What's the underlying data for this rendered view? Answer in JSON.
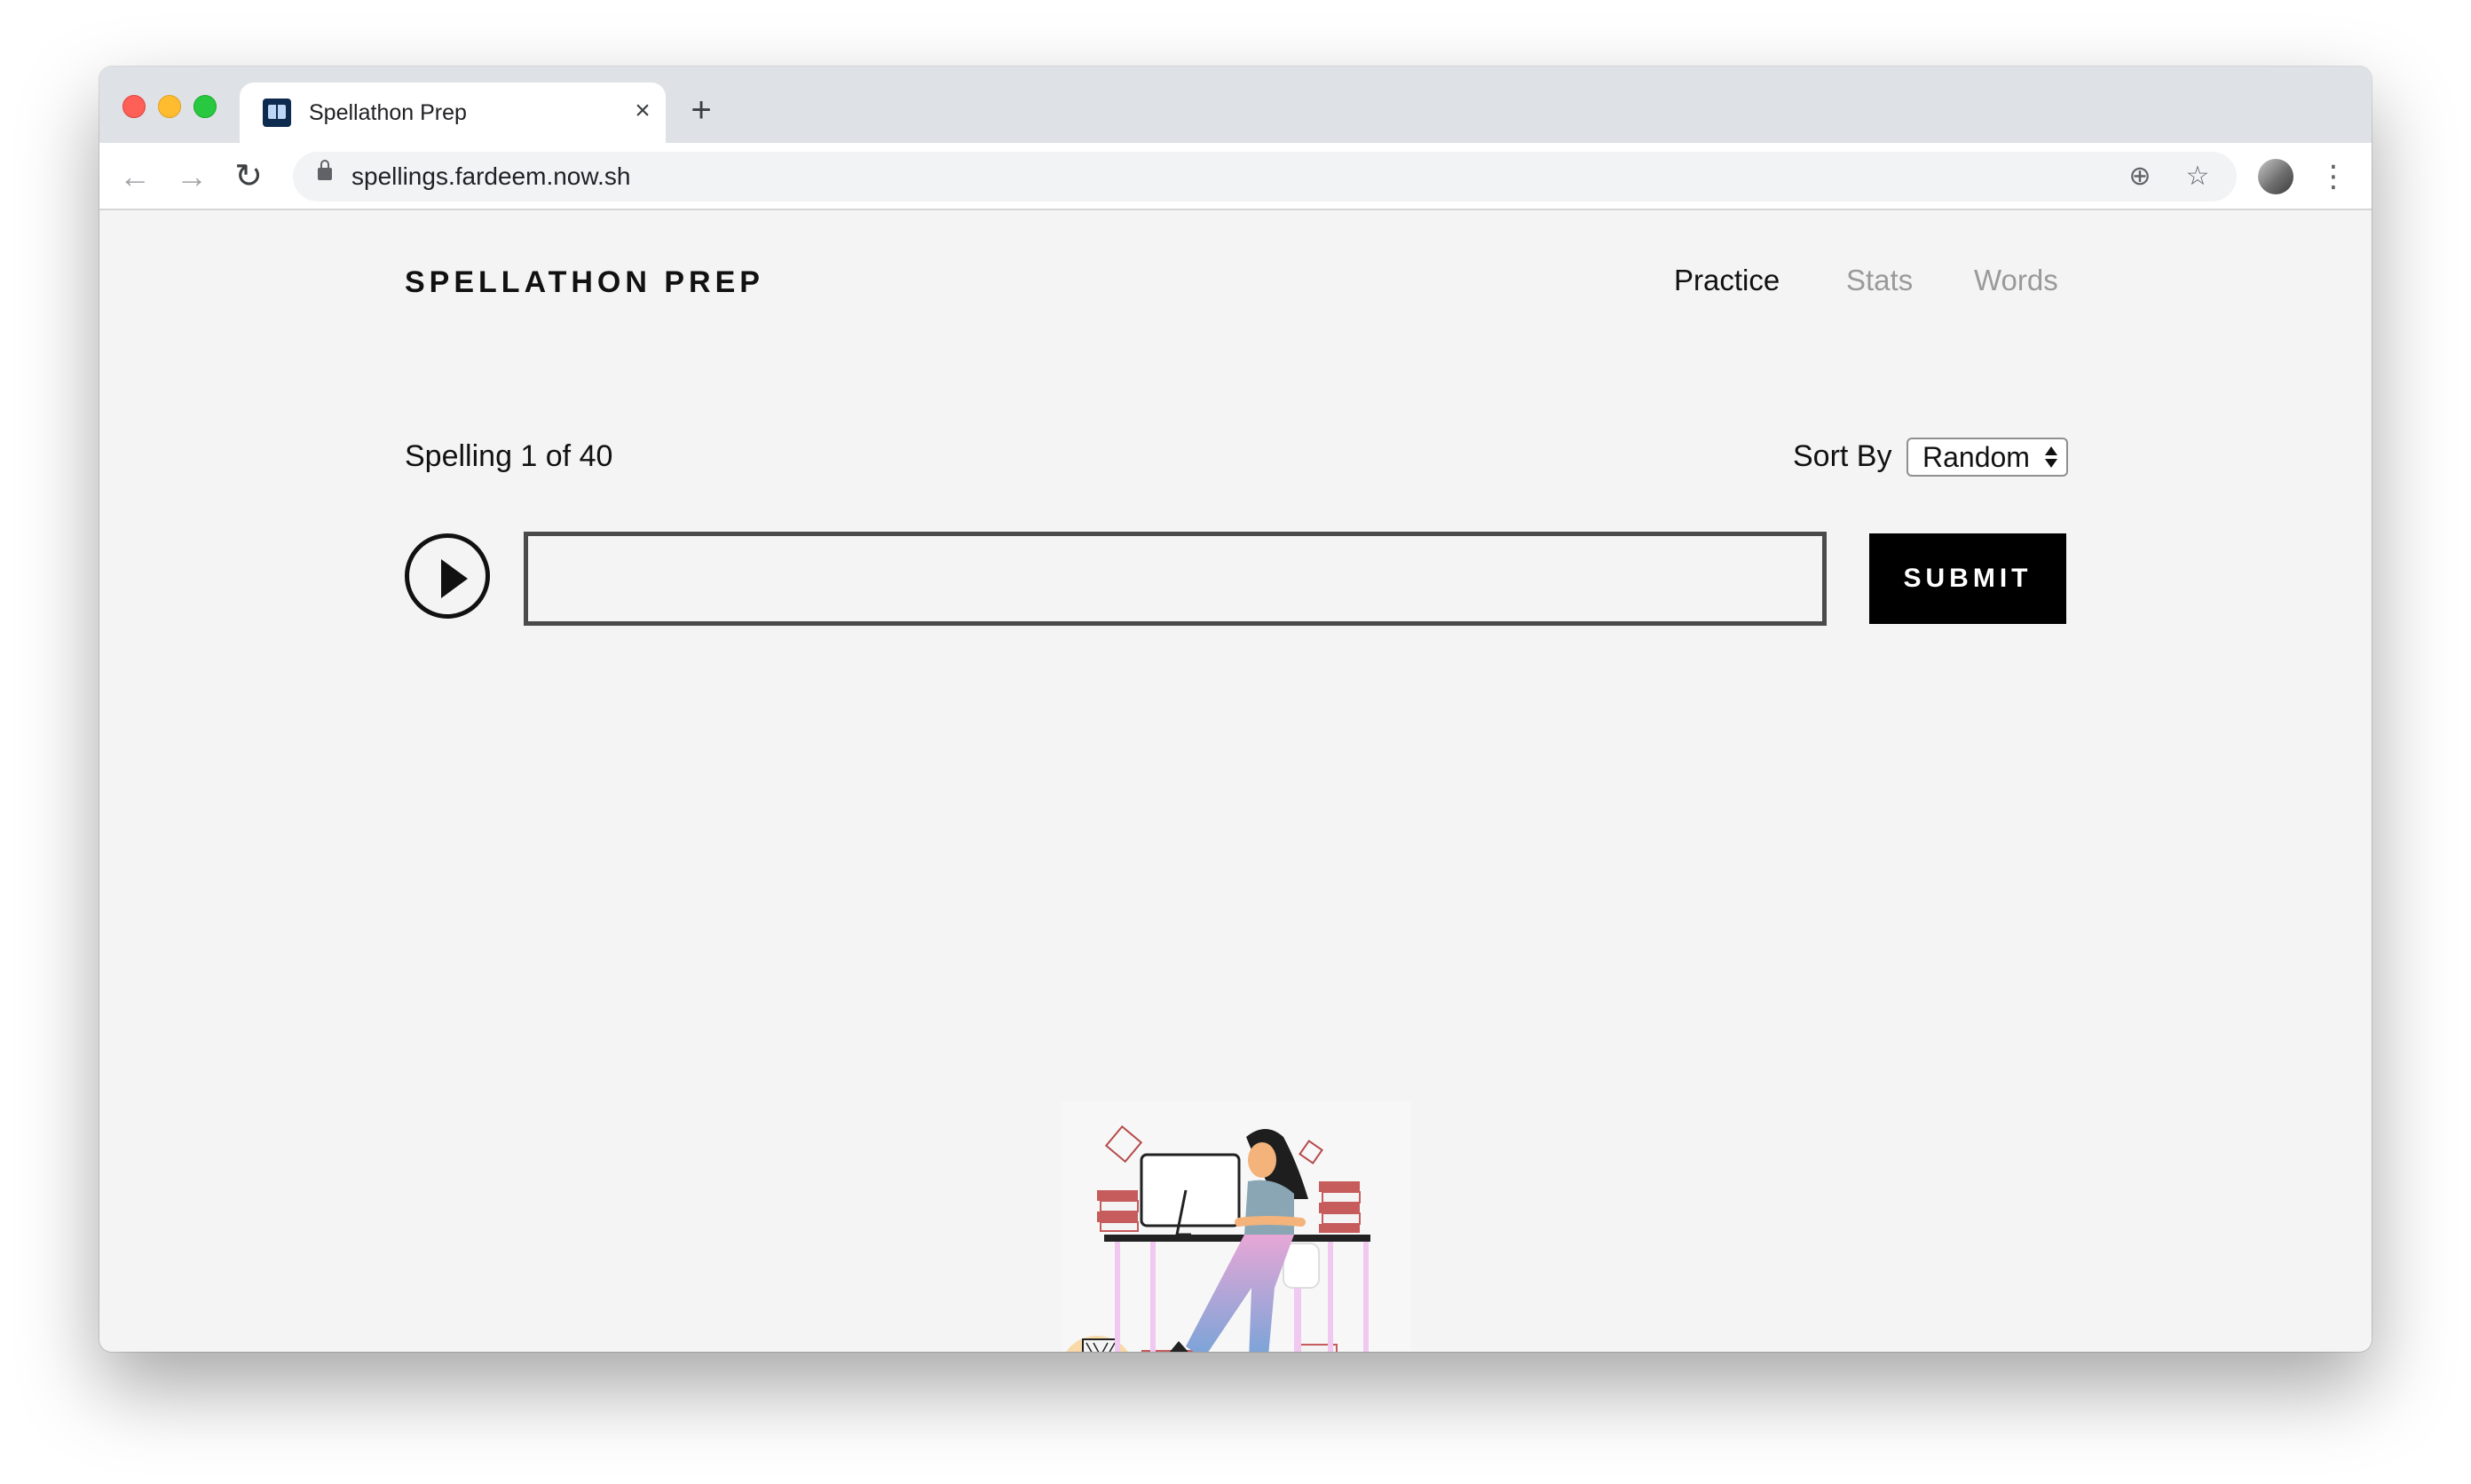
{
  "browser": {
    "tab_title": "Spellathon Prep",
    "tab_close": "×",
    "new_tab": "+",
    "url": "spellings.fardeem.now.sh",
    "back": "←",
    "forward": "→",
    "reload": "↻",
    "add_icon": "⊕",
    "star_icon": "☆",
    "menu": "⋮"
  },
  "header": {
    "brand": "SPELLATHON PREP",
    "nav": {
      "practice": "Practice",
      "stats": "Stats",
      "words": "Words"
    },
    "active_nav": "Practice"
  },
  "practice": {
    "counter": "Spelling 1 of 40",
    "sort_label": "Sort By",
    "sort_value": "Random",
    "answer_value": "",
    "submit_label": "SUBMIT"
  },
  "colors": {
    "page_bg": "#f4f4f4",
    "text": "#111111",
    "muted_nav": "#9a9a9a",
    "button_bg": "#000000",
    "button_text": "#ffffff"
  },
  "icons": {
    "play": "play-icon",
    "lock": "lock-icon",
    "star": "star-icon",
    "add": "add-to-page-icon",
    "profile": "profile-avatar",
    "menu": "kebab-menu-icon"
  }
}
